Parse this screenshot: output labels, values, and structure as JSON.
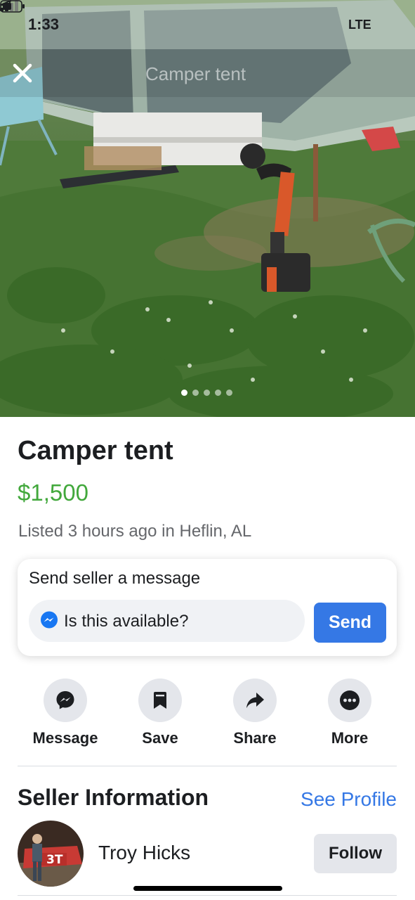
{
  "status_bar": {
    "time": "1:33",
    "network": "LTE",
    "icons": [
      "location-arrow-icon",
      "signal-bars-icon",
      "battery-icon"
    ]
  },
  "hero": {
    "overlay_title": "Camper tent",
    "photo_count": 5,
    "active_photo": 1
  },
  "listing": {
    "title": "Camper tent",
    "price": "$1,500",
    "meta": "Listed 3 hours ago in Heflin, AL",
    "price_color": "#42a83c"
  },
  "message_card": {
    "title": "Send seller a message",
    "input_value": "Is this available?",
    "send_label": "Send",
    "accent": "#3578e5"
  },
  "actions": [
    {
      "label": "Message",
      "icon": "messenger-icon"
    },
    {
      "label": "Save",
      "icon": "bookmark-icon"
    },
    {
      "label": "Share",
      "icon": "share-arrow-icon"
    },
    {
      "label": "More",
      "icon": "more-dots-icon"
    }
  ],
  "seller": {
    "heading": "Seller Information",
    "see_profile": "See Profile",
    "name": "Troy Hicks",
    "follow_label": "Follow",
    "avatar_text": "3T"
  }
}
